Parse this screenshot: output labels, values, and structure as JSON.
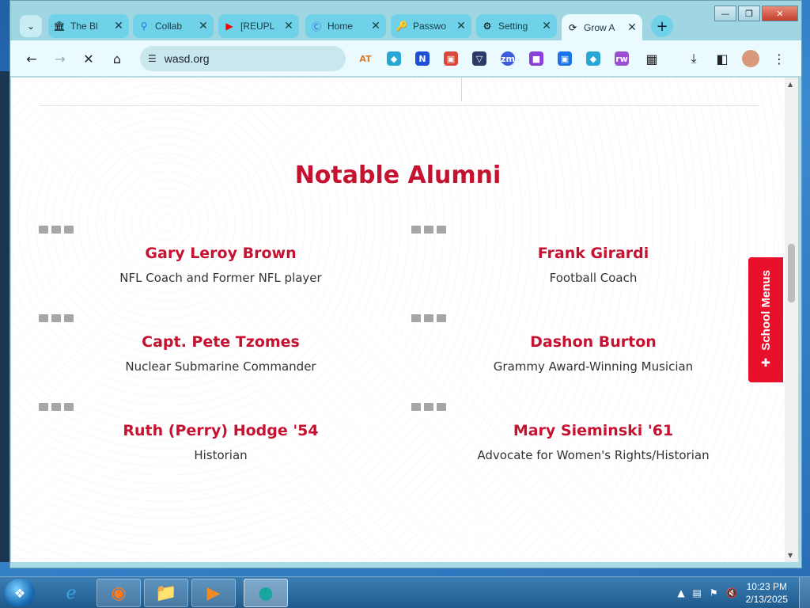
{
  "browser": {
    "tabs": [
      {
        "label": "The Bl",
        "icon": "bank-icon",
        "color": "#222222"
      },
      {
        "label": "Collab",
        "icon": "search-icon",
        "color": "#1a73e8"
      },
      {
        "label": "[REUPL",
        "icon": "youtube-icon",
        "color": "#ff0000"
      },
      {
        "label": "Home",
        "icon": "c-logo-icon",
        "color": "#3b5bdb"
      },
      {
        "label": "Passwo",
        "icon": "key-icon",
        "color": "#1a73e8"
      },
      {
        "label": "Setting",
        "icon": "gear-icon",
        "color": "#333333"
      },
      {
        "label": "Grow A",
        "icon": "loading-icon",
        "color": "#555555"
      }
    ],
    "url": "wasd.org",
    "extensions": [
      "AT",
      "◆",
      "N",
      "▣",
      "▽",
      "zm",
      "■",
      "▣",
      "◆",
      "rw"
    ]
  },
  "page": {
    "section_title": "Notable Alumni",
    "alumni": [
      {
        "name": "Gary Leroy Brown",
        "role": "NFL Coach and Former NFL player"
      },
      {
        "name": "Frank Girardi",
        "role": "Football Coach"
      },
      {
        "name": "Capt. Pete Tzomes",
        "role": "Nuclear Submarine Commander"
      },
      {
        "name": "Dashon Burton",
        "role": "Grammy Award-Winning Musician"
      },
      {
        "name": "Ruth (Perry) Hodge '54",
        "role": "Historian"
      },
      {
        "name": "Mary Sieminski '61",
        "role": "Advocate for Women's Rights/Historian"
      }
    ],
    "school_menus_label": "School Menus",
    "accent_color": "#c41230"
  },
  "taskbar": {
    "time": "10:23 PM",
    "date": "2/13/2025"
  }
}
